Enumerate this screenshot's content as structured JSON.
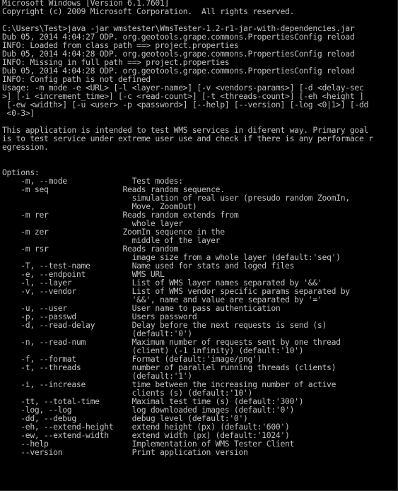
{
  "console": {
    "lines": [
      "Microsoft Windows [Version 6.1.7601]",
      "Copyright (c) 2009 Microsoft Corporation.  All rights reserved.",
      "",
      "C:\\Users\\Test>java -jar wmstester\\WmsTester-1.2-r1-jar-with-dependencies.jar",
      "Dub 05, 2014 4:04:27 ODP. org.geotools.grape.commons.PropertiesConfig reload",
      "INFO: Loaded from class path ==> project.properties",
      "Dub 05, 2014 4:04:28 ODP. org.geotools.grape.commons.PropertiesConfig reload",
      "INFO: Missing in full path ==> project.properties",
      "Dub 05, 2014 4:04:28 ODP. org.geotools.grape.commons.PropertiesConfig reload",
      "INFO: Config path is not defined",
      "Usage: -m mode -e <URL> [-l <layer-name>] [-v <vendors-params>] [-d <delay-sec",
      ">] [-i <increment_time>] [-c <read-count>] [-t <threads-count>] [-eh <height ]",
      " [-ew <width>] [-u <user> -p <password>] [--help] [--version] [-log <0|1>] [-dd",
      " <0-3>]",
      "",
      "This application is intended to test WMS services in diferent way. Primary goal",
      "is to test service under extreme user use and check if there is any performace r",
      "egression.",
      "",
      "",
      "Options:",
      "    -m, --mode              Test modes:",
      "    -m seq                Reads random sequence.",
      "                            simulation of real user (presudo random ZoomIn,",
      "                            Move, ZoomOut)",
      "    -m rer                Reads random extends from",
      "                            whole layer",
      "    -m zer                ZoomIn sequence in the",
      "                            middle of the layer",
      "    -m rsr                Reads random",
      "                            image size from a whole layer (default:'seq')",
      "    -T, --test-name         Name used for stats and loged files",
      "    -e, --endpoint          WMS URL",
      "    -l, --layer             List of WMS layer names separated by '&&'",
      "    -v, --vendor            List of WMS vendor specific params separated by",
      "                            '&&', name and value are separated by '='",
      "    -u, --user              User name to pass authentication",
      "    -p, --passwd            Users password",
      "    -d, --read-delay        Delay before the next requests is send (s)",
      "                            (default:'0')",
      "    -n, --read-num          Maximum number of requests sent by one thread",
      "                            (client) (-1 infinity) (default:'10')",
      "    -f, --format            Format (default:'image/png')",
      "    -t, --threads           number of parallel running threads (clients)",
      "                            (default:'1')",
      "    -i, --increase          time between the increasing number of active",
      "                            clients (s) (default:'10')",
      "    -tt, --total-time       Maximal test time (s) (default:'300')",
      "    -log, --log             log downloaded images (default:'0')",
      "    -dd, --debug            debug level (default:'0')",
      "    -eh, --extend-height    extend height (px) (default:'600')",
      "    -ew, --extend-width     extend width (px) (default:'1024')",
      "    --help                  Implementation of WMS Tester Client",
      "    --version               Print application version",
      "",
      "",
      "",
      ""
    ],
    "prompt": "C:\\Users\\Test>"
  },
  "colors": {
    "background": "#000000",
    "text": "#c0c0c0"
  }
}
